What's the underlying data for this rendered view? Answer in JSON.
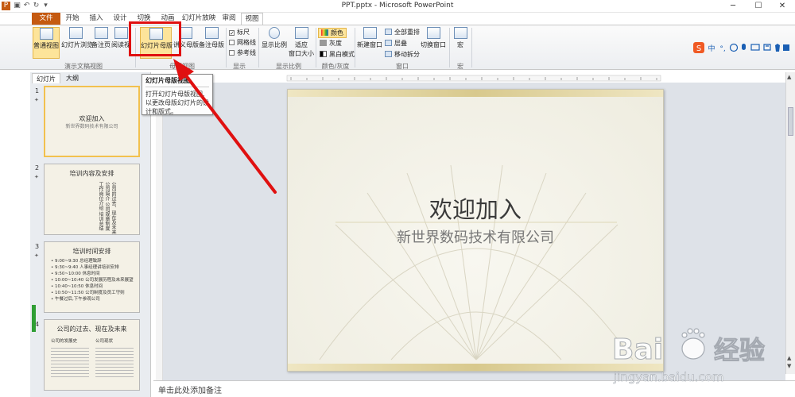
{
  "title": "PPT.pptx - Microsoft PowerPoint",
  "tabs": [
    "文件",
    "开始",
    "插入",
    "设计",
    "切换",
    "动画",
    "幻灯片放映",
    "审阅",
    "视图"
  ],
  "ribbon": {
    "b1": "普通视图",
    "b2": "幻灯片浏览",
    "b3": "备注页",
    "b4": "阅读视图",
    "b5": "幻灯片母版",
    "b6": "讲义母版",
    "b7": "备注母版",
    "g1": "演示文稿视图",
    "g2": "母版视图",
    "g3": "显示",
    "g4": "显示比例",
    "g5": "颜色/灰度",
    "g6": "窗口",
    "g7": "宏",
    "c1": "标尺",
    "c2": "网格线",
    "c3": "参考线",
    "z1": "显示比例",
    "z2": "适应",
    "z3": "窗口大小",
    "k1": "颜色",
    "k2": "灰度",
    "k3": "黑白模式",
    "w1": "新建窗口",
    "w2": "全部重排",
    "w3": "层叠",
    "w4": "移动拆分",
    "w5": "切换窗口",
    "m1": "宏"
  },
  "tooltip": {
    "title": "幻灯片母版视图",
    "body1": "打开幻灯片母版视图,",
    "body2": "以更改母版幻灯片的设",
    "body3": "计和版式。"
  },
  "panel": {
    "tab1": "幻灯片",
    "tab2": "大纲",
    "slides": [
      {
        "num": "1",
        "title": "欢迎加入",
        "sub": "新世界数码技术有限公司"
      },
      {
        "num": "2",
        "title": "培训内容及安排",
        "cols": [
          "公司的过去、现在及未来",
          "公司简介",
          "公司规章制度",
          "工作岗位介绍",
          "培训总结"
        ]
      },
      {
        "num": "3",
        "title": "培训时间安排",
        "rows": [
          [
            "9:00~9:30",
            "总经理致辞"
          ],
          [
            "9:30~9:40",
            "人事经理讲培训安排"
          ],
          [
            "9:50~10:00",
            "休息时间"
          ],
          [
            "10:00~10:40",
            "公司发展历程及未来展望"
          ],
          [
            "10:40~10:50",
            "休息时间"
          ],
          [
            "10:50~11:50",
            "公司制度及员工守则"
          ],
          [
            "午餐过后,下午参观公司",
            ""
          ]
        ]
      },
      {
        "num": "4",
        "title": "公司的过去、现在及未来",
        "left": "公司的发展史",
        "right": "公司现状"
      }
    ]
  },
  "slide": {
    "title": "欢迎加入",
    "subtitle": "新世界数码技术有限公司"
  },
  "notes": "单击此处添加备注",
  "watermark": {
    "brand": "Baidu",
    "cn": "经验",
    "url": "jingyan.baidu.com"
  },
  "colors": {
    "accent": "#c55a11",
    "highlight": "#e01010",
    "selected": "#f2c14e"
  }
}
